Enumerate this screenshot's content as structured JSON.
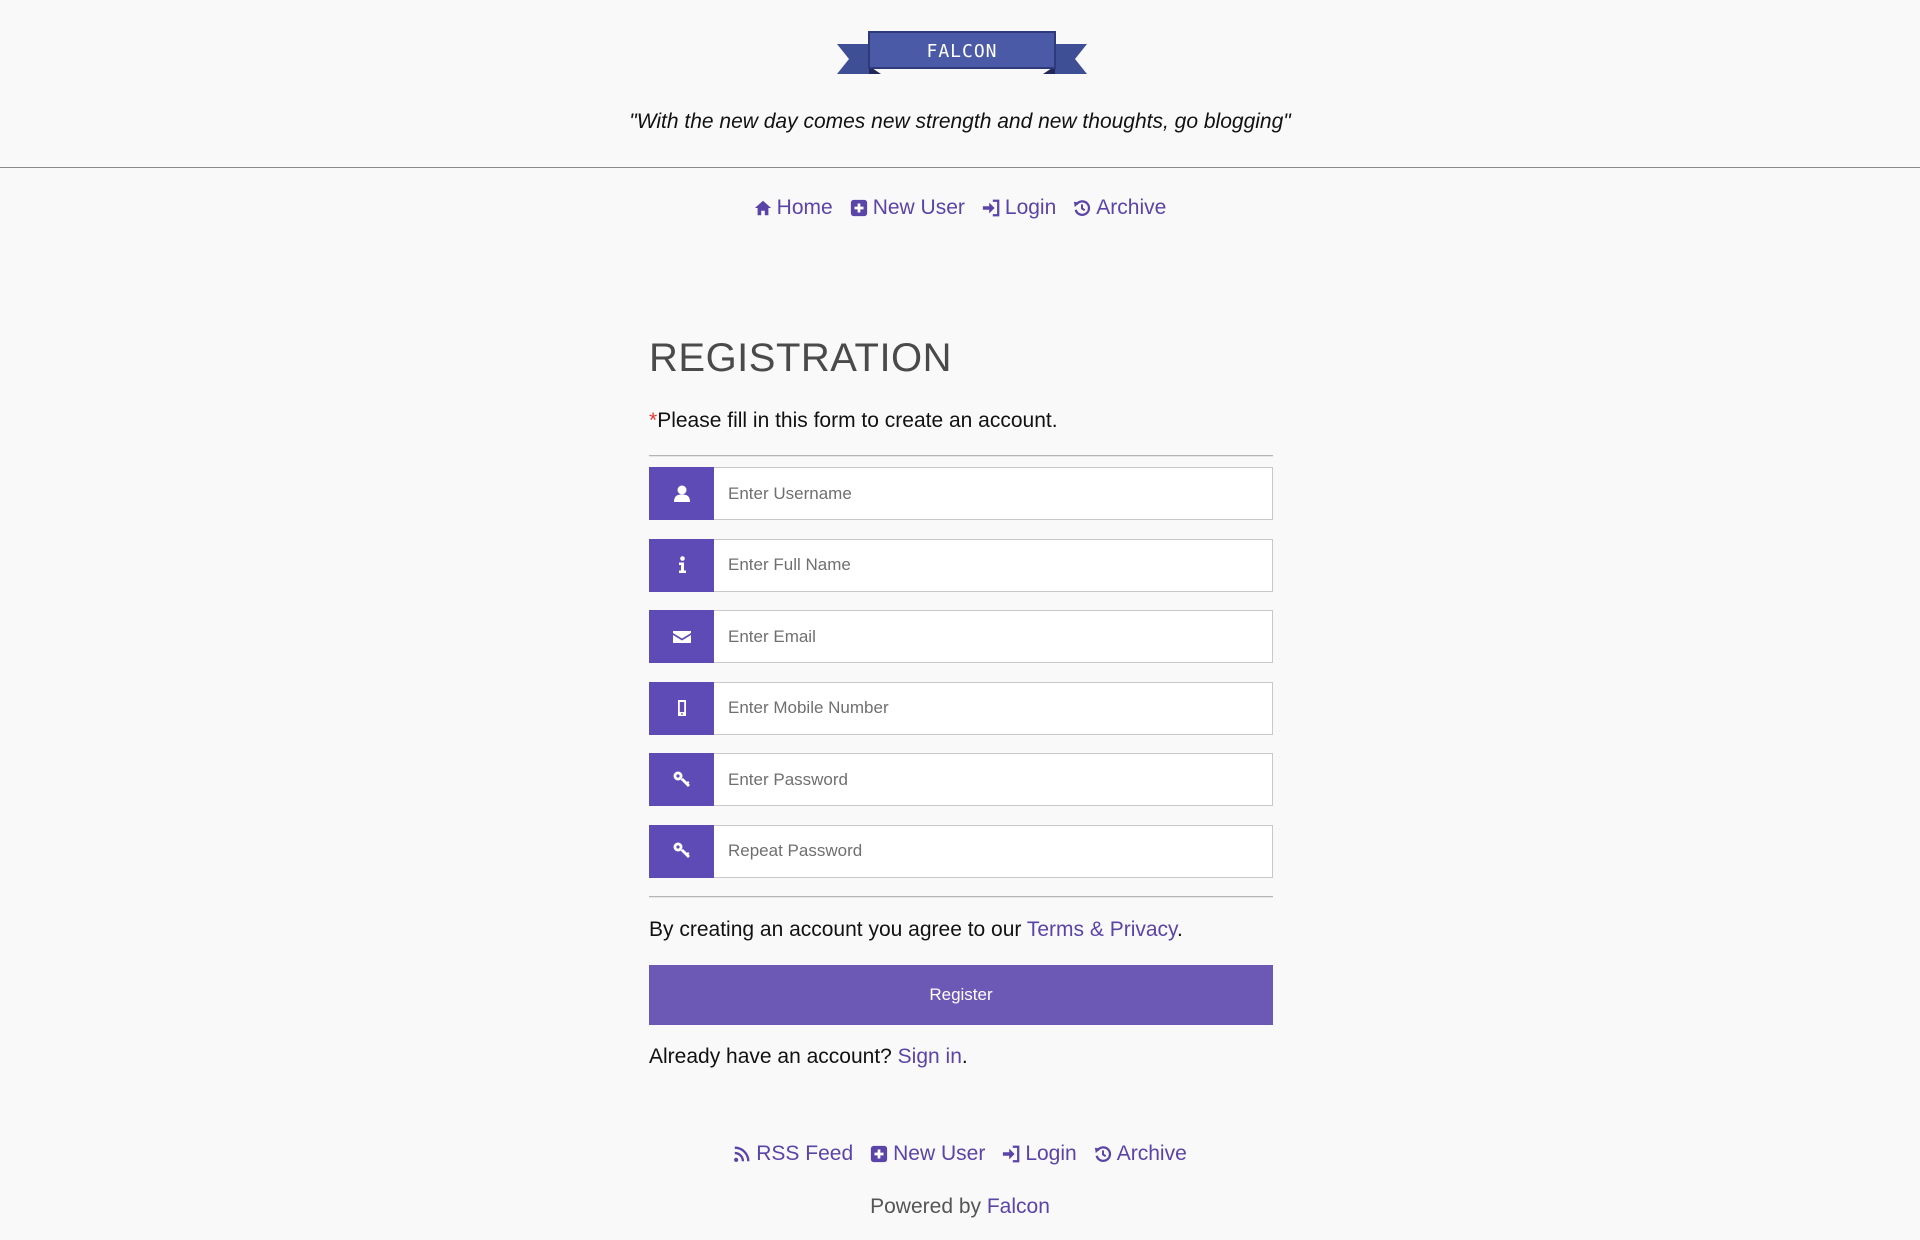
{
  "brand": {
    "logo_text": "FALCON",
    "accent": "#5f4bb6",
    "link_color": "#5b44a8"
  },
  "tagline": "\"With the new day comes new strength and new thoughts, go blogging\"",
  "nav": [
    {
      "icon": "home-icon",
      "label": "Home"
    },
    {
      "icon": "plus-square-icon",
      "label": "New User"
    },
    {
      "icon": "sign-in-icon",
      "label": "Login"
    },
    {
      "icon": "history-icon",
      "label": "Archive"
    }
  ],
  "form": {
    "title": "REGISTRATION",
    "required_mark": "*",
    "subtitle": "Please fill in this form to create an account.",
    "fields": [
      {
        "icon": "user-icon",
        "placeholder": "Enter Username",
        "value": ""
      },
      {
        "icon": "info-icon",
        "placeholder": "Enter Full Name",
        "value": ""
      },
      {
        "icon": "envelope-icon",
        "placeholder": "Enter Email",
        "value": ""
      },
      {
        "icon": "mobile-icon",
        "placeholder": "Enter Mobile Number",
        "value": ""
      },
      {
        "icon": "key-icon",
        "placeholder": "Enter Password",
        "value": ""
      },
      {
        "icon": "key-icon",
        "placeholder": "Repeat Password",
        "value": ""
      }
    ],
    "agree_prefix": "By creating an account you agree to our ",
    "agree_link": "Terms & Privacy",
    "agree_suffix": ".",
    "register_label": "Register",
    "signin_prefix": "Already have an account? ",
    "signin_link": "Sign in",
    "signin_suffix": "."
  },
  "footer": {
    "nav": [
      {
        "icon": "rss-icon",
        "label": "RSS Feed"
      },
      {
        "icon": "plus-square-icon",
        "label": "New User"
      },
      {
        "icon": "sign-in-icon",
        "label": "Login"
      },
      {
        "icon": "history-icon",
        "label": "Archive"
      }
    ],
    "powered_prefix": "Powered by ",
    "powered_link": "Falcon"
  }
}
